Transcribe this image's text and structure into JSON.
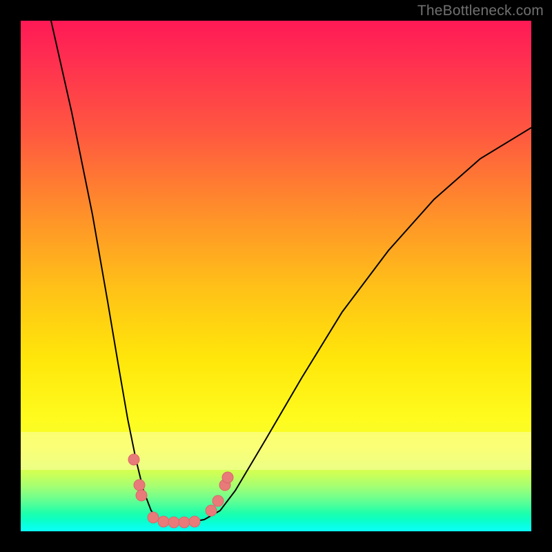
{
  "watermark": "TheBottleneck.com",
  "chart_data": {
    "type": "line",
    "title": "",
    "xlabel": "",
    "ylabel": "",
    "xlim": [
      0,
      100
    ],
    "ylim": [
      0,
      100
    ],
    "series": [
      {
        "name": "bottleneck-curve",
        "x": [
          6,
          10,
          14,
          17,
          19,
          21,
          22.5,
          24,
          25.5,
          27,
          30,
          33,
          36,
          39,
          42,
          48,
          55,
          63,
          72,
          81,
          90,
          100
        ],
        "values": [
          100,
          82,
          62,
          45,
          33,
          22,
          14,
          8,
          4,
          2.3,
          1.7,
          1.7,
          2.3,
          4,
          8,
          18,
          30,
          43,
          55,
          65,
          73,
          79
        ]
      }
    ],
    "markers": [
      {
        "x": 22.2,
        "y": 14,
        "label": "p1"
      },
      {
        "x": 23.3,
        "y": 9,
        "label": "p2"
      },
      {
        "x": 23.7,
        "y": 7,
        "label": "p3"
      },
      {
        "x": 26.0,
        "y": 2.7,
        "label": "p4"
      },
      {
        "x": 28.0,
        "y": 1.9,
        "label": "p5"
      },
      {
        "x": 30.0,
        "y": 1.7,
        "label": "p6"
      },
      {
        "x": 32.0,
        "y": 1.7,
        "label": "p7"
      },
      {
        "x": 34.0,
        "y": 1.9,
        "label": "p8"
      },
      {
        "x": 37.3,
        "y": 4,
        "label": "p9"
      },
      {
        "x": 38.7,
        "y": 6,
        "label": "p10"
      },
      {
        "x": 40.0,
        "y": 9,
        "label": "p11"
      },
      {
        "x": 40.6,
        "y": 10.5,
        "label": "p12"
      }
    ],
    "marker_color": "#e97a7a",
    "gradient_stops": [
      {
        "pos": 0,
        "color": "#ff1955"
      },
      {
        "pos": 0.35,
        "color": "#ff8a2c"
      },
      {
        "pos": 0.66,
        "color": "#ffe60a"
      },
      {
        "pos": 0.86,
        "color": "#f2ff30"
      },
      {
        "pos": 0.95,
        "color": "#48ff9c"
      },
      {
        "pos": 1.0,
        "color": "#0afff4"
      }
    ]
  }
}
